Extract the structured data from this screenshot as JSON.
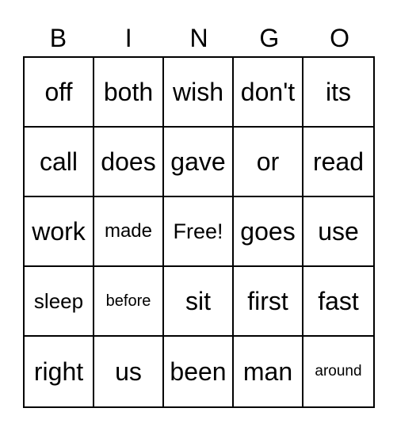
{
  "header": [
    "B",
    "I",
    "N",
    "G",
    "O"
  ],
  "cells": [
    [
      "off",
      "both",
      "wish",
      "don't",
      "its"
    ],
    [
      "call",
      "does",
      "gave",
      "or",
      "read"
    ],
    [
      "work",
      "made",
      "Free!",
      "goes",
      "use"
    ],
    [
      "sleep",
      "before",
      "sit",
      "first",
      "fast"
    ],
    [
      "right",
      "us",
      "been",
      "man",
      "around"
    ]
  ]
}
